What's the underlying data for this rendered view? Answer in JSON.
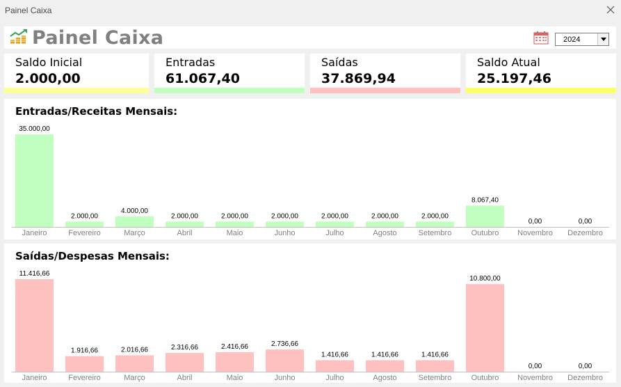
{
  "window": {
    "title": "Painel Caixa"
  },
  "header": {
    "title": "Painel Caixa",
    "year": "2024"
  },
  "cards": [
    {
      "label": "Saldo Inicial",
      "value": "2.000,00",
      "color": "#ffff99"
    },
    {
      "label": "Entradas",
      "value": "61.067,40",
      "color": "#c0ffc0"
    },
    {
      "label": "Saídas",
      "value": "37.869,94",
      "color": "#ffc0c0"
    },
    {
      "label": "Saldo Atual",
      "value": "25.197,46",
      "color": "#ffff66"
    }
  ],
  "chart_data": [
    {
      "type": "bar",
      "title": "Entradas/Receitas Mensais:",
      "categories": [
        "Janeiro",
        "Fevereiro",
        "Março",
        "Abril",
        "Maio",
        "Junho",
        "Julho",
        "Agosto",
        "Setembro",
        "Outubro",
        "Novembro",
        "Dezembro"
      ],
      "values": [
        35000,
        2000,
        4000,
        2000,
        2000,
        2000,
        2000,
        2000,
        2000,
        8067.4,
        0,
        0
      ],
      "labels": [
        "35.000,00",
        "2.000,00",
        "4.000,00",
        "2.000,00",
        "2.000,00",
        "2.000,00",
        "2.000,00",
        "2.000,00",
        "2.000,00",
        "8.067,40",
        "0,00",
        "0,00"
      ],
      "color": "#c0ffc0",
      "grid": false
    },
    {
      "type": "bar",
      "title": "Saídas/Despesas Mensais:",
      "categories": [
        "Janeiro",
        "Fevereiro",
        "Março",
        "Abril",
        "Maio",
        "Junho",
        "Julho",
        "Agosto",
        "Setembro",
        "Outubro",
        "Novembro",
        "Dezembro"
      ],
      "values": [
        11416.66,
        1916.66,
        2016.66,
        2316.66,
        2416.66,
        2736.66,
        1416.66,
        1416.66,
        1416.66,
        10800,
        0,
        0
      ],
      "labels": [
        "11.416,66",
        "1.916,66",
        "2.016,66",
        "2.316,66",
        "2.416,66",
        "2.736,66",
        "1.416,66",
        "1.416,66",
        "1.416,66",
        "10.800,00",
        "0,00",
        "0,00"
      ],
      "color": "#ffc0c0",
      "grid": false
    }
  ]
}
